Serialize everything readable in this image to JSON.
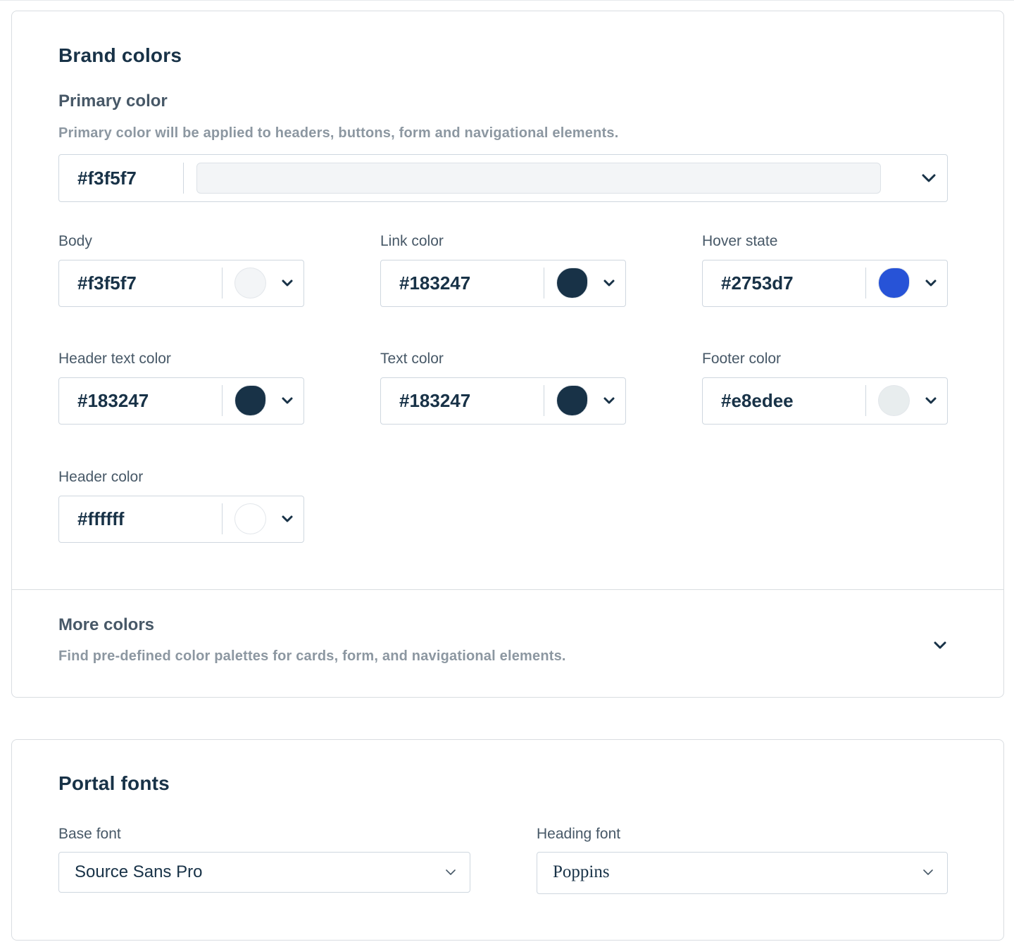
{
  "brand": {
    "title": "Brand colors",
    "primary": {
      "title": "Primary color",
      "help": "Primary color will be applied to headers, buttons, form and navigational elements.",
      "value": "#f3f5f7",
      "swatch_color": "#f3f5f7"
    },
    "fields": [
      {
        "label": "Body",
        "value": "#f3f5f7",
        "swatch_color": "#f3f5f7"
      },
      {
        "label": "Link color",
        "value": "#183247",
        "swatch_color": "#183247"
      },
      {
        "label": "Hover state",
        "value": "#2753d7",
        "swatch_color": "#2753d7"
      },
      {
        "label": "Header text color",
        "value": "#183247",
        "swatch_color": "#183247"
      },
      {
        "label": "Text color",
        "value": "#183247",
        "swatch_color": "#183247"
      },
      {
        "label": "Footer color",
        "value": "#e8edee",
        "swatch_color": "#e8edee"
      },
      {
        "label": "Header color",
        "value": "#ffffff",
        "swatch_color": "#ffffff"
      }
    ],
    "more": {
      "title": "More colors",
      "help": "Find pre-defined color palettes for cards, form, and navigational elements."
    }
  },
  "fonts": {
    "title": "Portal fonts",
    "base": {
      "label": "Base font",
      "value": "Source Sans Pro"
    },
    "heading": {
      "label": "Heading font",
      "value": "Poppins"
    }
  },
  "icons": {
    "chevron": "chevron-down-icon"
  }
}
